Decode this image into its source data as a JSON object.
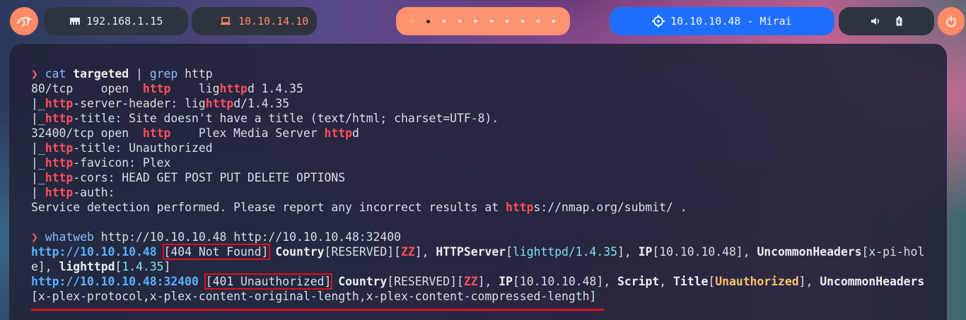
{
  "topbar": {
    "ip": "192.168.1.15",
    "vpn_ip": "10.10.14.10",
    "target": "10.10.10.48 - Mirai",
    "workspaces": [
      "1",
      "2",
      "3",
      "4",
      "5",
      "6",
      "7",
      "8",
      "9",
      "10"
    ],
    "active_workspace": 2,
    "icons": {
      "logo": "kali-dragon-icon",
      "ip": "network-card-icon",
      "vpn": "laptop-icon",
      "target": "crosshair-icon",
      "volume": "volume-icon",
      "battery": "battery-icon",
      "power": "power-icon"
    }
  },
  "terminal": {
    "prompt_symbol": "❯",
    "cmd1": {
      "a": "cat",
      "b": " targeted",
      "c": " | ",
      "d": "grep",
      "e": " http"
    },
    "nmap": {
      "l1": {
        "a": "80/tcp    open  ",
        "b": "http",
        "c": "    lig",
        "d": "http",
        "e": "d 1.4.35"
      },
      "l2": {
        "a": "|_",
        "b": "http",
        "c": "-server-header: lig",
        "d": "http",
        "e": "d/1.4.35"
      },
      "l3": {
        "a": "|_",
        "b": "http",
        "c": "-title: Site doesn't have a title (text/html; charset=UTF-8)."
      },
      "l4": {
        "a": "32400/tcp open  ",
        "b": "http",
        "c": "    Plex Media Server ",
        "d": "http",
        "e": "d"
      },
      "l5": {
        "a": "|_",
        "b": "http",
        "c": "-title: Unauthorized"
      },
      "l6": {
        "a": "|_",
        "b": "http",
        "c": "-favicon: Plex"
      },
      "l7": {
        "a": "|_",
        "b": "http",
        "c": "-cors: HEAD GET POST PUT DELETE OPTIONS"
      },
      "l8": {
        "a": "| ",
        "b": "http",
        "c": "-auth:"
      },
      "l9": {
        "a": "Service detection performed. Please report any incorrect results at ",
        "b": "http",
        "c": "s://nmap.org/submit/ ."
      }
    },
    "cmd2": {
      "a": "whatweb",
      "b": " http://10.10.10.48 http://10.10.10.48:32400"
    },
    "ww1": {
      "url": "http://10.10.10.48",
      "status": "[404 Not Found]",
      "country_k": "Country",
      "country_v": "[RESERVED]",
      "zz_l": "[",
      "zz": "ZZ",
      "zz_r": "]",
      "httpserver_k": "HTTPServer",
      "httpserver_l": "[",
      "httpserver_v": "lighttpd/1.4.35",
      "httpserver_r": "]",
      "ip_k": "IP",
      "ip_v": "[10.10.10.48]",
      "uh_k": "UncommonHeaders",
      "uh_v1": "[x-pi-hol",
      "uh_v2": "e]",
      "lighttpd_k": "lighttpd",
      "lighttpd_l": "[",
      "lighttpd_v": "1.4.35",
      "lighttpd_r": "]"
    },
    "ww2": {
      "url": "http://10.10.10.48:32400",
      "status": "[401 Unauthorized]",
      "country_k": "Country",
      "country_v": "[RESERVED]",
      "zz_l": "[",
      "zz": "ZZ",
      "zz_r": "]",
      "ip_k": "IP",
      "ip_v": "[10.10.10.48]",
      "script_k": "Script",
      "title_k": "Title",
      "title_l": "[",
      "title_v": "Unauthorized",
      "title_r": "]",
      "uh_k": "UncommonHeaders",
      "uh_v": "[x-plex-protocol,x-plex-content-original-length,x-plex-content-compressed-length]"
    }
  }
}
